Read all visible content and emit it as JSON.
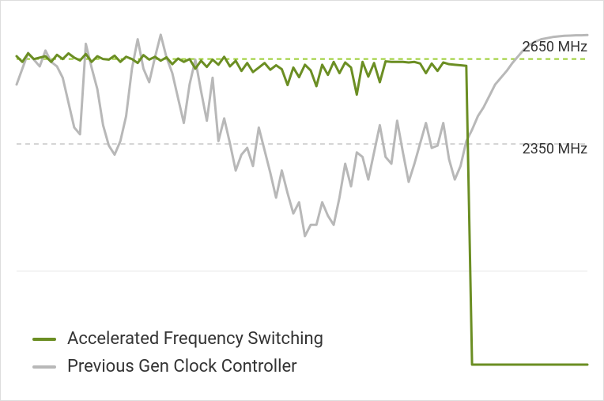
{
  "chart_data": {
    "type": "line",
    "x_count": 100,
    "xlabel": "",
    "ylabel": "",
    "ylim": [
      1500,
      2800
    ],
    "reference_lines": [
      {
        "label": "2650 MHz",
        "value": 2650,
        "color": "#9acd32"
      },
      {
        "label": "2350 MHz",
        "value": 2350,
        "color": "#d5d5d5"
      }
    ],
    "baseline_value": 1900,
    "series": [
      {
        "name": "Accelerated Frequency Switching",
        "color": "#6b8e23",
        "values": [
          2660,
          2640,
          2670,
          2650,
          2655,
          2660,
          2640,
          2665,
          2650,
          2670,
          2655,
          2645,
          2668,
          2640,
          2660,
          2650,
          2648,
          2662,
          2640,
          2658,
          2650,
          2636,
          2664,
          2648,
          2658,
          2644,
          2656,
          2632,
          2652,
          2640,
          2650,
          2616,
          2644,
          2622,
          2648,
          2630,
          2658,
          2624,
          2644,
          2608,
          2636,
          2604,
          2620,
          2636,
          2612,
          2628,
          2614,
          2558,
          2620,
          2586,
          2630,
          2610,
          2554,
          2630,
          2594,
          2640,
          2600,
          2638,
          2620,
          2524,
          2640,
          2588,
          2636,
          2568,
          2642,
          2640,
          2640,
          2640,
          2638,
          2640,
          2634,
          2600,
          2634,
          2608,
          2638,
          2632,
          2630,
          2628,
          2626,
          1570,
          1570,
          1570,
          1570,
          1570,
          1570,
          1570,
          1570,
          1570,
          1570,
          1570,
          1570,
          1570,
          1570,
          1570,
          1570,
          1570,
          1570,
          1570,
          1570,
          1570
        ]
      },
      {
        "name": "Previous Gen Clock Controller",
        "color": "#b8b8b8",
        "values": [
          2560,
          2616,
          2672,
          2648,
          2624,
          2680,
          2640,
          2624,
          2584,
          2496,
          2408,
          2384,
          2704,
          2620,
          2544,
          2416,
          2344,
          2312,
          2360,
          2448,
          2616,
          2720,
          2616,
          2568,
          2656,
          2736,
          2656,
          2600,
          2512,
          2424,
          2560,
          2648,
          2536,
          2432,
          2584,
          2360,
          2440,
          2352,
          2256,
          2312,
          2336,
          2272,
          2408,
          2328,
          2248,
          2160,
          2256,
          2176,
          2104,
          2144,
          2024,
          2064,
          2064,
          2144,
          2096,
          2064,
          2160,
          2280,
          2200,
          2320,
          2304,
          2224,
          2320,
          2416,
          2304,
          2280,
          2432,
          2320,
          2216,
          2280,
          2352,
          2424,
          2336,
          2344,
          2424,
          2296,
          2224,
          2272,
          2360,
          2400,
          2448,
          2480,
          2520,
          2560,
          2584,
          2608,
          2636,
          2660,
          2684,
          2700,
          2712,
          2720,
          2724,
          2728,
          2730,
          2732,
          2733,
          2734,
          2734,
          2735
        ]
      }
    ]
  },
  "legend": {
    "items": [
      {
        "label": "Accelerated Frequency Switching"
      },
      {
        "label": "Previous Gen Clock Controller"
      }
    ]
  },
  "labels": {
    "ref_upper": "2650 MHz",
    "ref_lower": "2350 MHz"
  }
}
